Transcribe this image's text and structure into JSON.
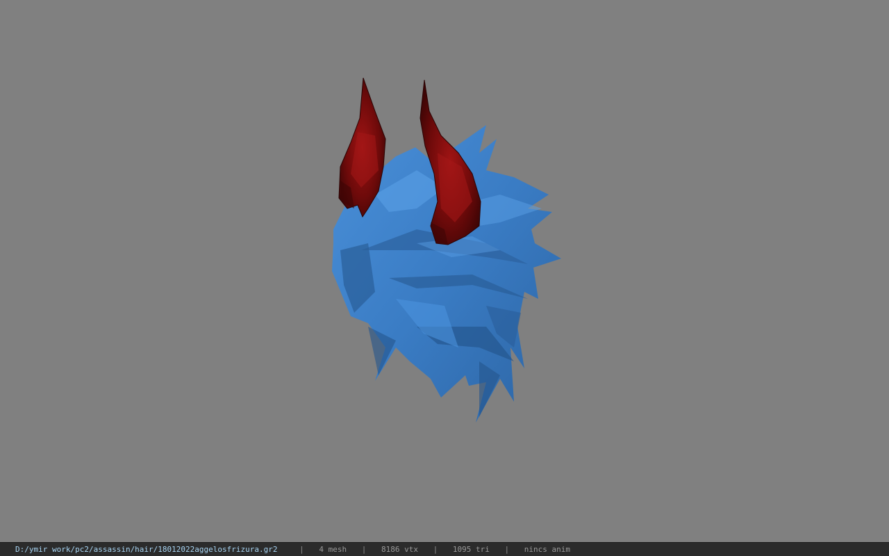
{
  "status_bar": {
    "file_path": "D:/ymir work/pc2/assassin/hair/18012022aggelosfrizura.gr2",
    "separator": "|",
    "mesh_count": "4 mesh",
    "vertex_count": "8186 vtx",
    "triangle_count": "1095 tri",
    "animation": "nincs anim"
  },
  "colors": {
    "viewport_background": "#808080",
    "status_bar_background": "#2b2b2b",
    "path_text": "#a9d6f5",
    "hair_main": "#3d82cc",
    "horn_main": "#7a0c0c"
  }
}
